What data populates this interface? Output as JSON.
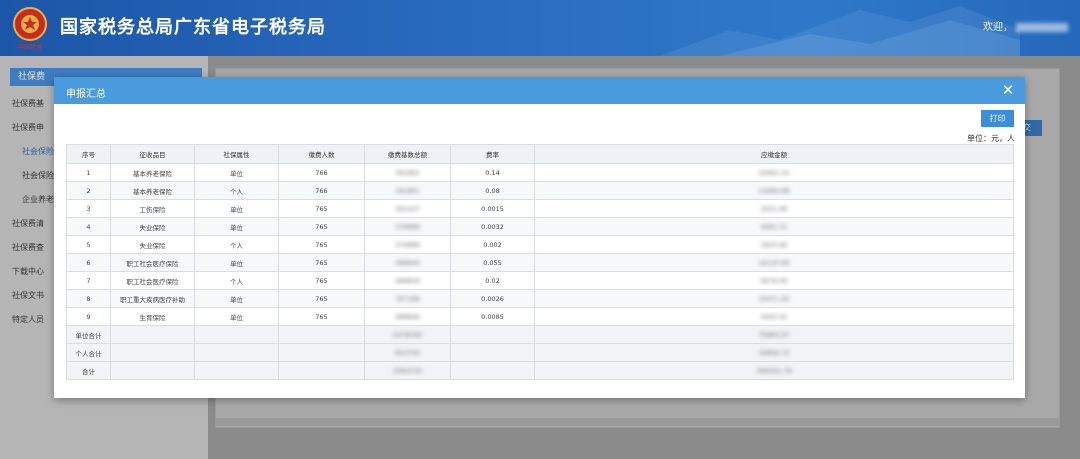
{
  "header": {
    "site_title": "国家税务总局广东省电子税务局",
    "welcome_prefix": "欢迎，",
    "emblem_caption": "中国税务"
  },
  "sidebar": {
    "head_label": "社保费",
    "items": [
      {
        "label": "社保费基",
        "active": false
      },
      {
        "label": "社保费申",
        "active": false
      },
      {
        "label": "社会保险",
        "active": true
      },
      {
        "label": "社会保险",
        "active": false
      },
      {
        "label": "企业养老",
        "active": false
      },
      {
        "label": "社保费清",
        "active": false
      },
      {
        "label": "社保费查",
        "active": false
      },
      {
        "label": "下载中心",
        "active": false
      },
      {
        "label": "社保文书",
        "active": false
      },
      {
        "label": "特定人员",
        "active": false
      }
    ]
  },
  "background": {
    "submit_label": "交"
  },
  "modal": {
    "title": "申报汇总",
    "close_label": "✕",
    "print_label": "打印",
    "unit_note": "单位：元，人",
    "columns": [
      "序号",
      "征收品目",
      "社保属性",
      "缴费人数",
      "缴费基数总额",
      "费率",
      "应缴金额"
    ],
    "rows": [
      {
        "no": "1",
        "item": "基本养老保险",
        "attr": "单位",
        "count": "766",
        "base": "391861",
        "rate": "0.14",
        "amount": "42691.54"
      },
      {
        "no": "2",
        "item": "基本养老保险",
        "attr": "个人",
        "count": "766",
        "base": "391861",
        "rate": "0.08",
        "amount": "24966.88"
      },
      {
        "no": "3",
        "item": "工伤保险",
        "attr": "单位",
        "count": "765",
        "base": "391437",
        "rate": "0.0015",
        "amount": "1631.99"
      },
      {
        "no": "4",
        "item": "失业保险",
        "attr": "单位",
        "count": "765",
        "base": "376898",
        "rate": "0.0032",
        "amount": "5661.01"
      },
      {
        "no": "5",
        "item": "失业保险",
        "attr": "个人",
        "count": "765",
        "base": "376898",
        "rate": "0.002",
        "amount": "1820.66"
      },
      {
        "no": "6",
        "item": "职工社会医疗保险",
        "attr": "单位",
        "count": "765",
        "base": "489846",
        "rate": "0.055",
        "amount": "26120.66"
      },
      {
        "no": "7",
        "item": "职工社会医疗保险",
        "attr": "个人",
        "count": "765",
        "base": "489846",
        "rate": "0.02",
        "amount": "9676.06"
      },
      {
        "no": "8",
        "item": "职工重大疾病医疗补助",
        "attr": "单位",
        "count": "765",
        "base": "787188",
        "rate": "0.0026",
        "amount": "2047L.69"
      },
      {
        "no": "9",
        "item": "生育保险",
        "attr": "单位",
        "count": "765",
        "base": "489846",
        "rate": "0.0085",
        "amount": "4063.42"
      }
    ],
    "totals": [
      {
        "label": "单位合计",
        "base": "2479190",
        "amount": "75884.97"
      },
      {
        "label": "个人合计",
        "base": "653750",
        "amount": "34856.72"
      },
      {
        "label": "合计",
        "base": "3364150",
        "amount": "396301.79"
      }
    ]
  }
}
